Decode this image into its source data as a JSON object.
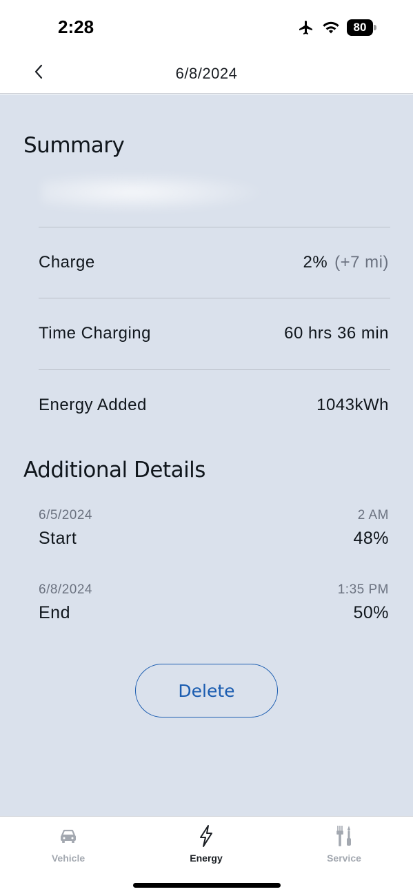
{
  "status_bar": {
    "time": "2:28",
    "battery_level": "80",
    "icons": [
      "airplane-icon",
      "wifi-icon",
      "battery-icon"
    ]
  },
  "header": {
    "title": "6/8/2024",
    "back_icon": "chevron-left-icon"
  },
  "summary": {
    "title": "Summary",
    "rows": [
      {
        "label": "Charge",
        "value": "2%",
        "sub_value": "(+7 mi)"
      },
      {
        "label": "Time Charging",
        "value": "60 hrs 36 min"
      },
      {
        "label": "Energy Added",
        "value": "1043kWh"
      }
    ]
  },
  "additional_details": {
    "title": "Additional Details",
    "items": [
      {
        "date": "6/5/2024",
        "time": "2 AM",
        "label": "Start",
        "value": "48%"
      },
      {
        "date": "6/8/2024",
        "time": "1:35 PM",
        "label": "End",
        "value": "50%"
      }
    ]
  },
  "actions": {
    "delete_label": "Delete"
  },
  "tabs": [
    {
      "label": "Vehicle",
      "icon": "car-icon",
      "active": false
    },
    {
      "label": "Energy",
      "icon": "lightning-icon",
      "active": true
    },
    {
      "label": "Service",
      "icon": "tools-icon",
      "active": false
    }
  ],
  "colors": {
    "background": "#dae1ec",
    "accent": "#1a5cb0",
    "muted_text": "#6b7280"
  }
}
